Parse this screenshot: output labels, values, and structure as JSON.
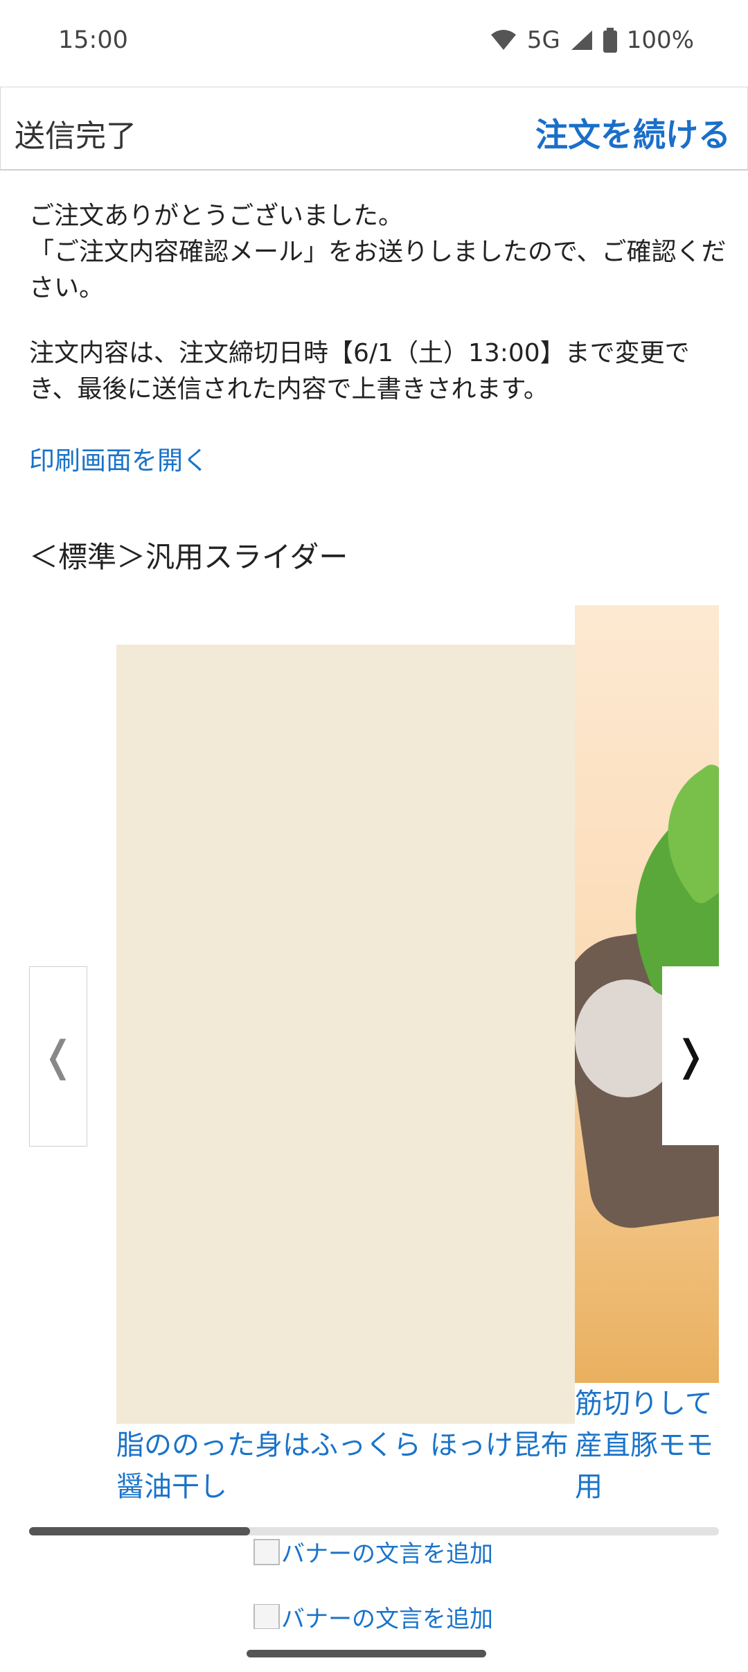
{
  "status_bar": {
    "time": "15:00",
    "network": "5G",
    "battery": "100%"
  },
  "header": {
    "title": "送信完了",
    "action": "注文を続ける"
  },
  "message": {
    "thanks_line1": "ご注文ありがとうございました。",
    "thanks_line2": "「ご注文内容確認メール」をお送りしましたので、ご確認ください。",
    "change_notice": "注文内容は、注文締切日時【6/1（土）13:00】まで変更でき、最後に送信された内容で上書きされます。",
    "print_link": "印刷画面を開く"
  },
  "slider": {
    "heading": "＜標準＞汎用スライダー",
    "slides": [
      {
        "caption": "脂ののった身はふっくら ほっけ昆布醤油干し"
      },
      {
        "caption_line1": "筋切りして",
        "caption_line2": "産直豚モモ",
        "caption_line3": "用"
      }
    ],
    "prev_glyph": "❬",
    "next_glyph": "❭",
    "scroll_progress": 0.32
  },
  "banners": [
    {
      "alt": "バナーの文言を追加"
    },
    {
      "alt": "バナーの文言を追加"
    }
  ]
}
